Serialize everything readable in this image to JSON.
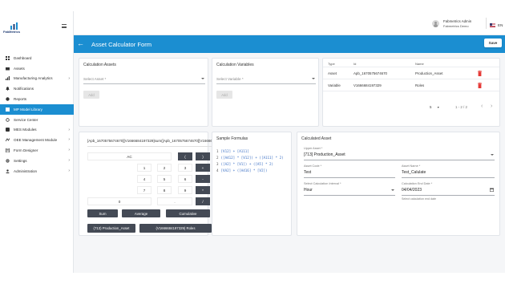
{
  "brand": {
    "name": "FabMetrics"
  },
  "user": {
    "name": "Fabmetrics Admin",
    "org": "Fabmetrics Demo"
  },
  "language": {
    "code": "EN"
  },
  "sidebar": {
    "items": [
      {
        "label": "Dashboard",
        "icon": "dashboard-icon",
        "chevron": false
      },
      {
        "label": "Assets",
        "icon": "assets-icon",
        "chevron": false
      },
      {
        "label": "Manufacturing Analytics",
        "icon": "analytics-icon",
        "chevron": true
      },
      {
        "label": "Notifications",
        "icon": "bell-icon",
        "chevron": false
      },
      {
        "label": "Reports",
        "icon": "reports-icon",
        "chevron": false
      },
      {
        "label": "MP Model Library",
        "icon": "library-icon",
        "chevron": false,
        "active": true
      },
      {
        "label": "Service Center",
        "icon": "service-icon",
        "chevron": false
      },
      {
        "label": "MES Modules",
        "icon": "mes-icon",
        "chevron": true
      },
      {
        "label": "OEE Management Module",
        "icon": "oee-icon",
        "chevron": true
      },
      {
        "label": "Form Designer",
        "icon": "form-icon",
        "chevron": true
      },
      {
        "label": "Settings",
        "icon": "gear-icon",
        "chevron": true
      },
      {
        "label": "Administration",
        "icon": "admin-icon",
        "chevron": true
      }
    ]
  },
  "header": {
    "title": "Asset Calculator Form",
    "save_label": "Save"
  },
  "calc_assets": {
    "title": "Calculation Assets",
    "placeholder": "Select Asset *",
    "add_label": "Add"
  },
  "calc_vars": {
    "title": "Calculation Variables",
    "placeholder": "Select Variable *",
    "add_label": "Add"
  },
  "table": {
    "columns": [
      "Type",
      "Id",
      "Name"
    ],
    "rows": [
      {
        "type": "Asset",
        "id": "Apb_1670575674670",
        "name": "Production_Asset"
      },
      {
        "type": "Variable",
        "id": "V1666684197329",
        "name": "Roles"
      }
    ],
    "rows_per_page": "5",
    "range": "1 - 2 / 2"
  },
  "calculator": {
    "expression": "[Apb_1670575674670][V1666684197329]sum([Apb_1670575674670][V1666684197329])",
    "keys": {
      "ac": "AC",
      "lparen": "(",
      "rparen": ")",
      "k1": "1",
      "k2": "2",
      "k3": "3",
      "plus": "+",
      "k4": "4",
      "k5": "5",
      "k6": "6",
      "minus": "-",
      "k7": "7",
      "k8": "8",
      "k9": "9",
      "times": "*",
      "k0": "0",
      "dot": ".",
      "divide": "/"
    },
    "sum_label": "Sum",
    "average_label": "Average",
    "cumulative_label": "Cumulative",
    "chip_asset": "(713) Production_Asset",
    "chip_variable": "(V1666684197329) Roles"
  },
  "samples": {
    "title": "Sample Formulas",
    "items": [
      {
        "n": "1",
        "text": "[V12] + [A111]"
      },
      {
        "n": "2",
        "text": "([A412] * [V12]) + ([A111] * 2)"
      },
      {
        "n": "3",
        "text": "([A2] * [V1]) + ([A5] * 2)"
      },
      {
        "n": "4",
        "text": "[VA2] + ([A416] * [V2])"
      }
    ]
  },
  "calculated": {
    "title": "Calculated Asset",
    "upper_asset_label": "Upper Asset *",
    "upper_asset_value": "[713] Production_Asset",
    "asset_code_label": "Asset Code *",
    "asset_code_value": "Test",
    "asset_name_label": "Asset Name *",
    "asset_name_value": "Test_Calulate",
    "interval_label": "Select Calculation Interval *",
    "interval_value": "Hour",
    "end_date_label": "Calculation End Date *",
    "end_date_value": "04/04/2023",
    "end_date_helper": "Select calculation end date"
  },
  "colors": {
    "primary": "#1b8ed1",
    "dark_button": "#444a55",
    "delete": "#e53935"
  }
}
